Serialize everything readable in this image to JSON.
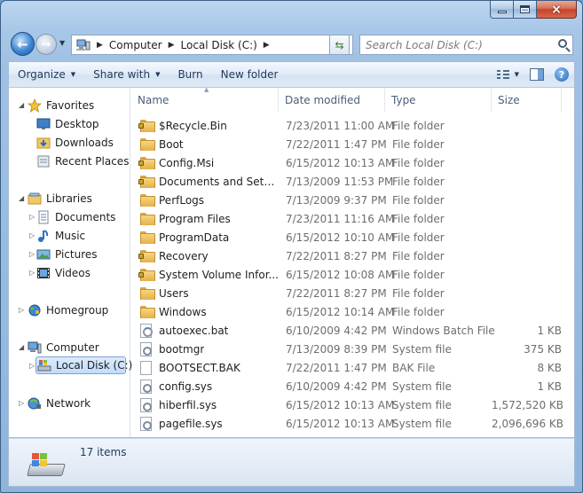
{
  "window": {
    "caption_buttons": {
      "minimize": "minimize",
      "maximize": "maximize",
      "close": "×"
    }
  },
  "nav": {
    "breadcrumb": [
      "Computer",
      "Local Disk (C:)"
    ],
    "search_placeholder": "Search Local Disk (C:)"
  },
  "toolbar": {
    "organize": "Organize",
    "share_with": "Share with",
    "burn": "Burn",
    "new_folder": "New folder"
  },
  "sidebar": {
    "favorites": {
      "label": "Favorites",
      "items": [
        "Desktop",
        "Downloads",
        "Recent Places"
      ]
    },
    "libraries": {
      "label": "Libraries",
      "items": [
        "Documents",
        "Music",
        "Pictures",
        "Videos"
      ]
    },
    "homegroup": {
      "label": "Homegroup"
    },
    "computer": {
      "label": "Computer",
      "items": [
        "Local Disk (C:)"
      ]
    },
    "network": {
      "label": "Network"
    }
  },
  "columns": {
    "name": "Name",
    "date": "Date modified",
    "type": "Type",
    "size": "Size"
  },
  "files": [
    {
      "name": "$Recycle.Bin",
      "date": "7/23/2011 11:00 AM",
      "type": "File folder",
      "size": "",
      "icon": "folder-locked-icon"
    },
    {
      "name": "Boot",
      "date": "7/22/2011 1:47 PM",
      "type": "File folder",
      "size": "",
      "icon": "folder-icon"
    },
    {
      "name": "Config.Msi",
      "date": "6/15/2012 10:13 AM",
      "type": "File folder",
      "size": "",
      "icon": "folder-locked-icon"
    },
    {
      "name": "Documents and Setti...",
      "date": "7/13/2009 11:53 PM",
      "type": "File folder",
      "size": "",
      "icon": "folder-locked-icon"
    },
    {
      "name": "PerfLogs",
      "date": "7/13/2009 9:37 PM",
      "type": "File folder",
      "size": "",
      "icon": "folder-icon"
    },
    {
      "name": "Program Files",
      "date": "7/23/2011 11:16 AM",
      "type": "File folder",
      "size": "",
      "icon": "folder-icon"
    },
    {
      "name": "ProgramData",
      "date": "6/15/2012 10:10 AM",
      "type": "File folder",
      "size": "",
      "icon": "folder-icon"
    },
    {
      "name": "Recovery",
      "date": "7/22/2011 8:27 PM",
      "type": "File folder",
      "size": "",
      "icon": "folder-locked-icon"
    },
    {
      "name": "System Volume Infor...",
      "date": "6/15/2012 10:08 AM",
      "type": "File folder",
      "size": "",
      "icon": "folder-locked-icon"
    },
    {
      "name": "Users",
      "date": "7/22/2011 8:27 PM",
      "type": "File folder",
      "size": "",
      "icon": "folder-icon"
    },
    {
      "name": "Windows",
      "date": "6/15/2012 10:14 AM",
      "type": "File folder",
      "size": "",
      "icon": "folder-icon"
    },
    {
      "name": "autoexec.bat",
      "date": "6/10/2009 4:42 PM",
      "type": "Windows Batch File",
      "size": "1 KB",
      "icon": "batch-file-icon"
    },
    {
      "name": "bootmgr",
      "date": "7/13/2009 8:39 PM",
      "type": "System file",
      "size": "375 KB",
      "icon": "system-file-icon"
    },
    {
      "name": "BOOTSECT.BAK",
      "date": "7/22/2011 1:47 PM",
      "type": "BAK File",
      "size": "8 KB",
      "icon": "file-icon"
    },
    {
      "name": "config.sys",
      "date": "6/10/2009 4:42 PM",
      "type": "System file",
      "size": "1 KB",
      "icon": "system-file-icon"
    },
    {
      "name": "hiberfil.sys",
      "date": "6/15/2012 10:13 AM",
      "type": "System file",
      "size": "1,572,520 KB",
      "icon": "system-file-icon"
    },
    {
      "name": "pagefile.sys",
      "date": "6/15/2012 10:13 AM",
      "type": "System file",
      "size": "2,096,696 KB",
      "icon": "system-file-icon"
    }
  ],
  "status": {
    "items": "17 items"
  }
}
